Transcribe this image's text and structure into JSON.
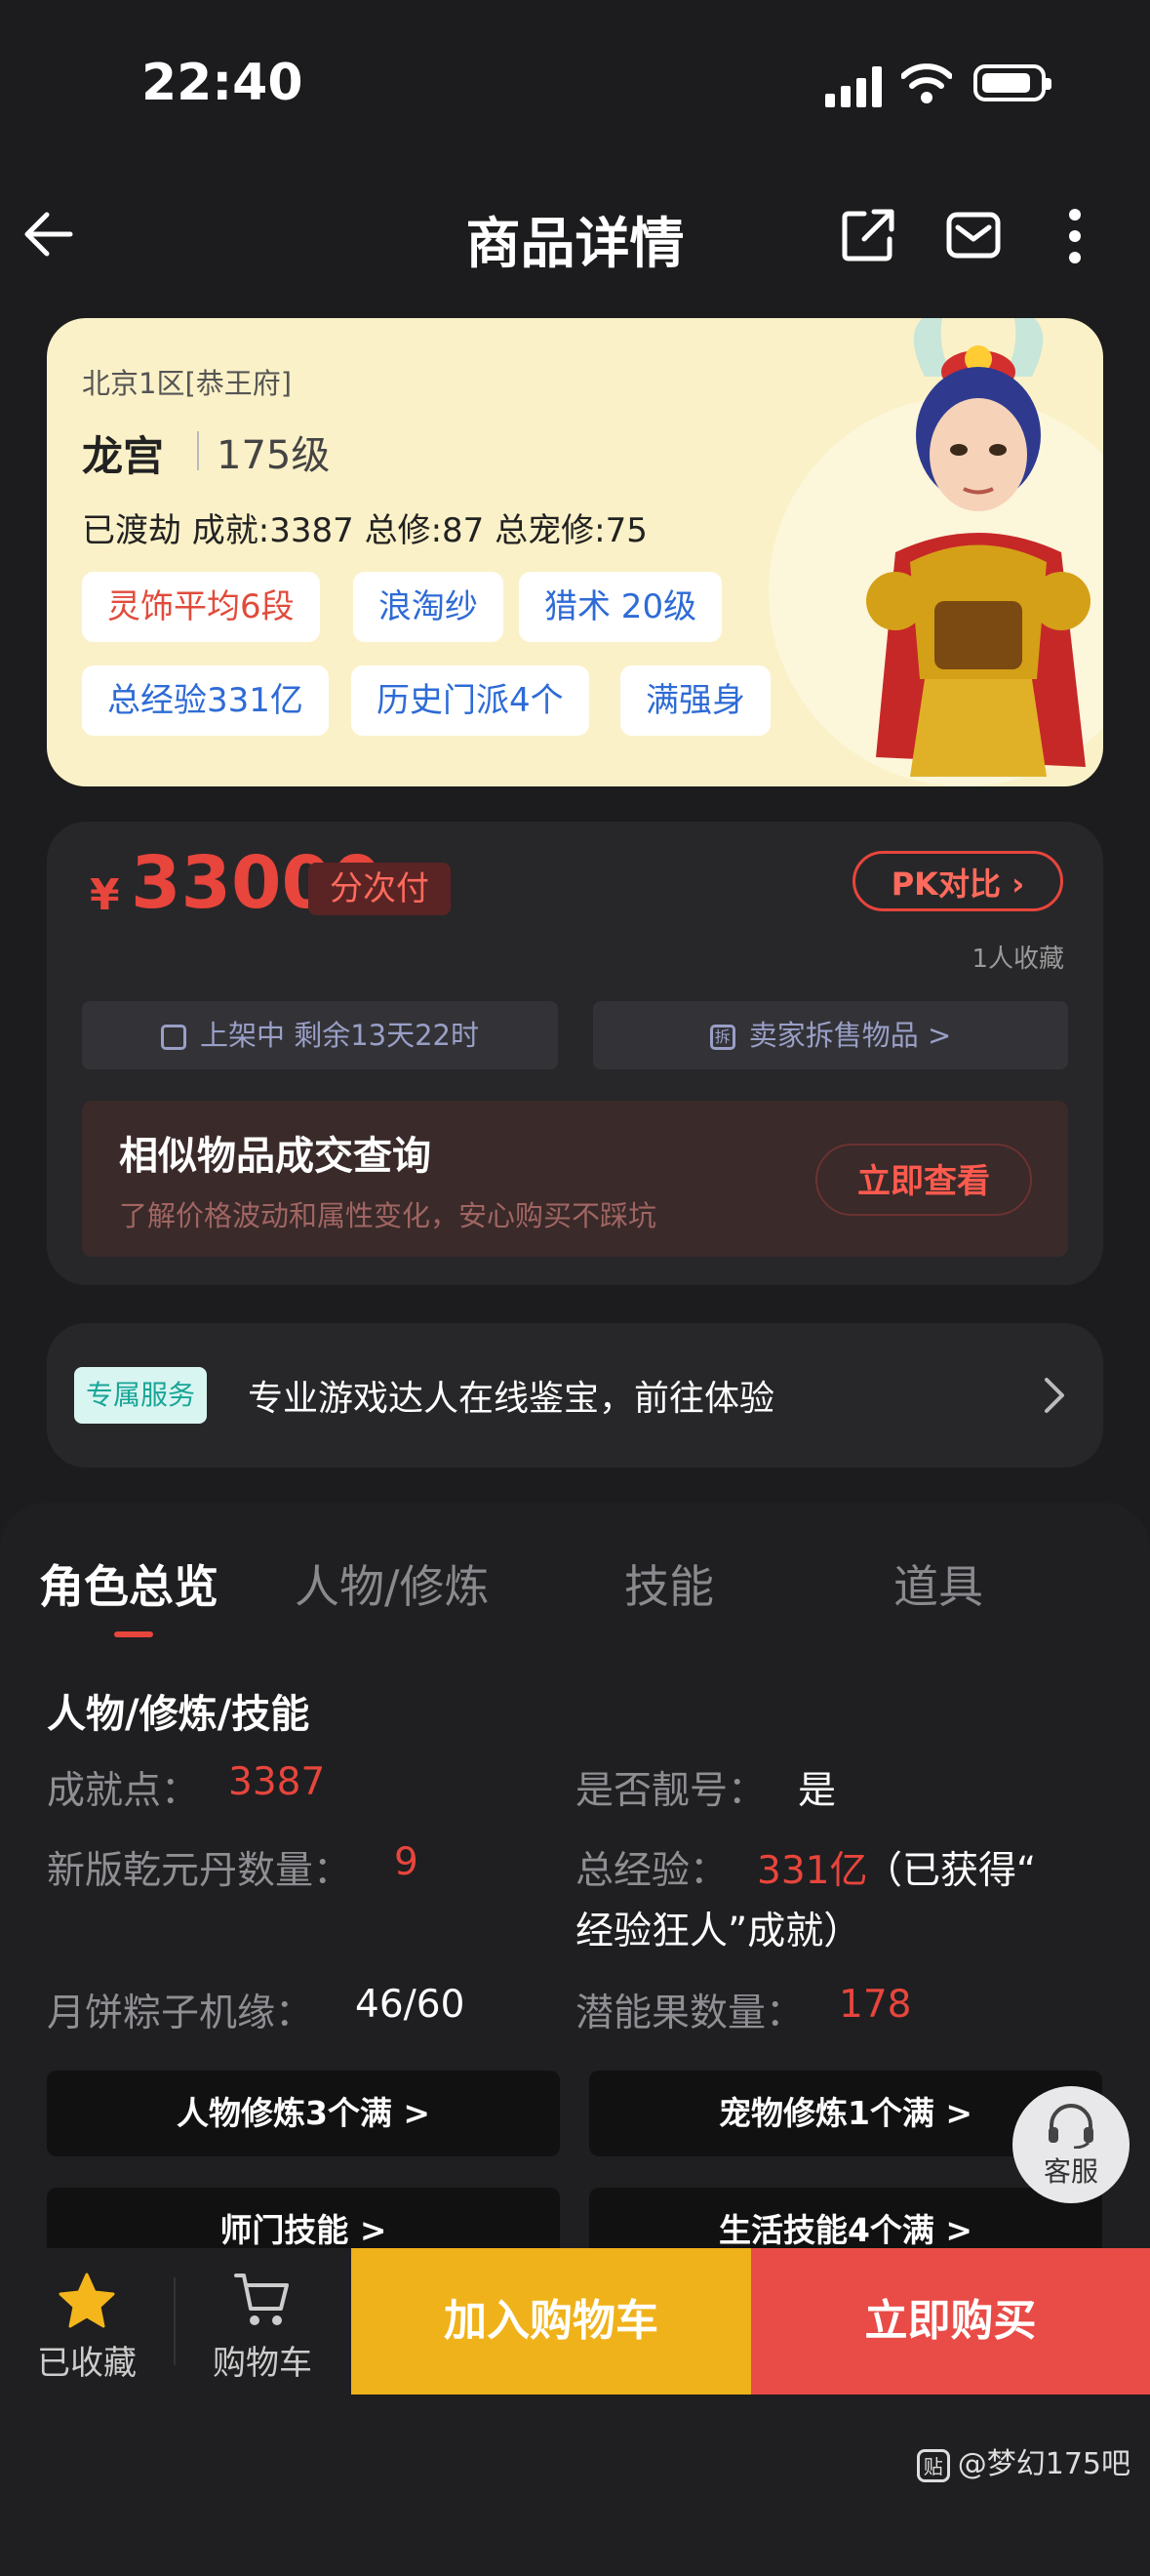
{
  "status_bar": {
    "time": "22:40"
  },
  "nav": {
    "title": "商品详情"
  },
  "character": {
    "server": "北京1区[恭王府]",
    "school": "龙宫",
    "level": "175级",
    "stats": "已渡劫 成就:3387 总修:87 总宠修:75",
    "tags_row1": [
      "灵饰平均6段",
      "浪淘纱",
      "猎术 20级"
    ],
    "tags_row2": [
      "总经验331亿",
      "历史门派4个",
      "满强身"
    ]
  },
  "price": {
    "currency": "¥",
    "amount": "33000",
    "installment": "分次付",
    "pk_label": "PK对比",
    "fav_count": "1人收藏",
    "listing_status": "上架中 剩余13天22时",
    "seller_split": "卖家拆售物品 >",
    "similar_title": "相似物品成交查询",
    "similar_sub": "了解价格波动和属性变化，安心购买不踩坑",
    "view_now": "立即查看"
  },
  "service": {
    "badge": "专属服务",
    "text": "专业游戏达人在线鉴宝，前往体验"
  },
  "tabs": [
    "角色总览",
    "人物/修炼",
    "技能",
    "道具"
  ],
  "detail": {
    "section_title": "人物/修炼/技能",
    "achievement_label": "成就点：",
    "achievement_value": "3387",
    "pretty_id_label": "是否靓号：",
    "pretty_id_value": "是",
    "pill_label": "新版乾元丹数量：",
    "pill_value": "9",
    "exp_label": "总经验：",
    "exp_value": "331亿",
    "exp_note_1": "（已获得“",
    "exp_note_2": "经验狂人”成就）",
    "mooncake_label": "月饼粽子机缘：",
    "mooncake_value": "46/60",
    "potential_label": "潜能果数量：",
    "potential_value": "178",
    "btn_char_cult": "人物修炼3个满 >",
    "btn_pet_cult": "宠物修炼1个满 >",
    "btn_school_skill": "师门技能 >",
    "btn_life_skill": "生活技能4个满 >"
  },
  "customer_service": {
    "label": "客服"
  },
  "bottom_bar": {
    "favorited": "已收藏",
    "cart": "购物车",
    "add_cart": "加入购物车",
    "buy_now": "立即购买"
  },
  "watermark": {
    "logo": "贴",
    "text": "@梦幻175吧"
  },
  "colors": {
    "accent_red": "#e8453c",
    "tag_blue": "#2e6bd6",
    "card_yellow": "#fbf1c8",
    "cart_yellow": "#f0b21a",
    "buy_red": "#e94b47",
    "service_teal": "#18a597"
  },
  "icons": [
    "back-arrow-icon",
    "share-icon",
    "mail-icon",
    "more-icon",
    "calendar-icon",
    "split-icon",
    "chevron-right-icon",
    "headset-icon",
    "star-icon",
    "cart-icon"
  ]
}
